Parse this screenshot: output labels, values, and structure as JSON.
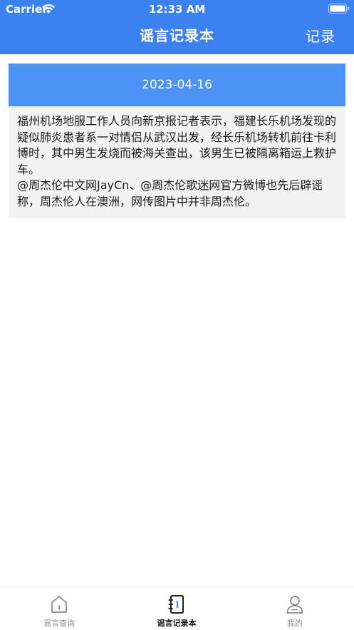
{
  "status_bar": {
    "carrier": "Carrier",
    "time": "12:33 AM"
  },
  "nav": {
    "title": "谣言记录本",
    "right_button": "记录"
  },
  "record": {
    "date": "2023-04-16",
    "paragraphs": [
      "福州机场地服工作人员向新京报记者表示，福建长乐机场发现的疑似肺炎患者系一对情侣从武汉出发，经长乐机场转机前往卡利博时，其中男生发烧而被海关查出，该男生已被隔离箱运上救护车。",
      "@周杰伦中文网JayCn、@周杰伦歌迷网官方微博也先后辟谣称，周杰伦人在澳洲，网传图片中并非周杰伦。"
    ]
  },
  "tabbar": {
    "tabs": [
      {
        "label": "谣言查询",
        "icon": "home-icon",
        "active": false
      },
      {
        "label": "谣言记录本",
        "icon": "notebook-icon",
        "active": true
      },
      {
        "label": "我的",
        "icon": "user-icon",
        "active": false
      }
    ]
  },
  "colors": {
    "brand_blue": "#3b82f0",
    "date_bar_blue": "#4d93f6",
    "card_background": "#f2f2f2"
  }
}
